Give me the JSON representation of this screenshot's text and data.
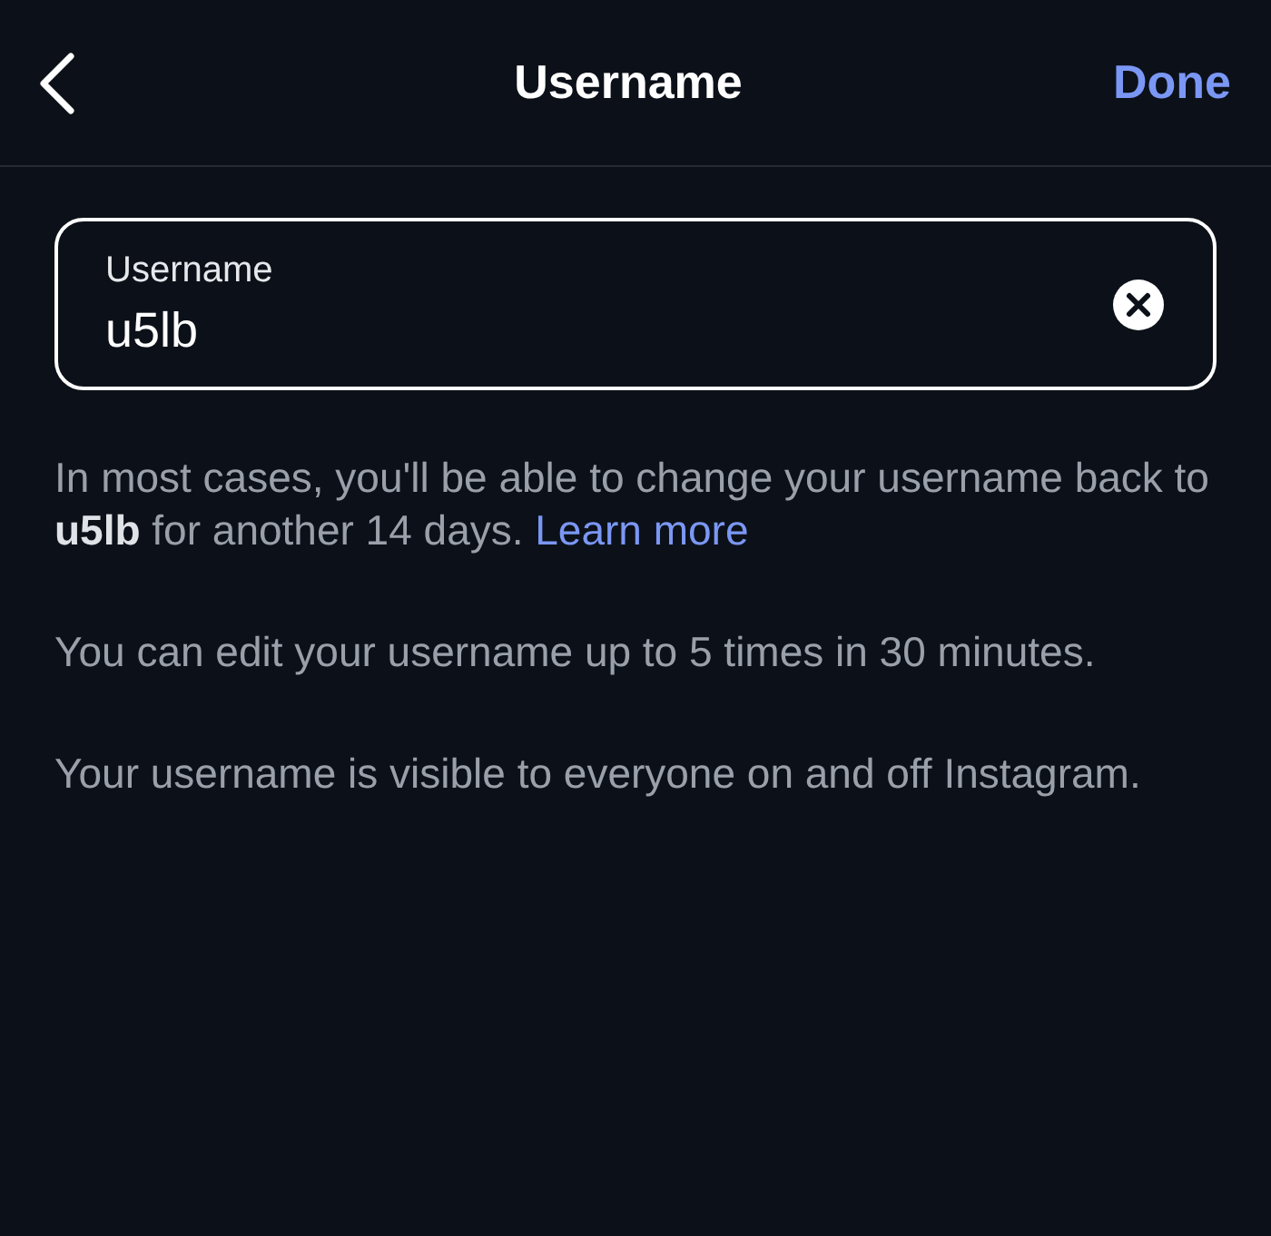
{
  "header": {
    "title": "Username",
    "done": "Done"
  },
  "field": {
    "label": "Username",
    "value": "u5lb"
  },
  "notes": [
    {
      "text": "In most cases, you'll be able to change your username back to **u5lb** for another 14 days.",
      "link": "Learn more"
    },
    {
      "text": "You can edit your username up to 5 times in 30 minutes."
    },
    {
      "text": "Your username is visible to everyone on and off Instagram."
    }
  ]
}
